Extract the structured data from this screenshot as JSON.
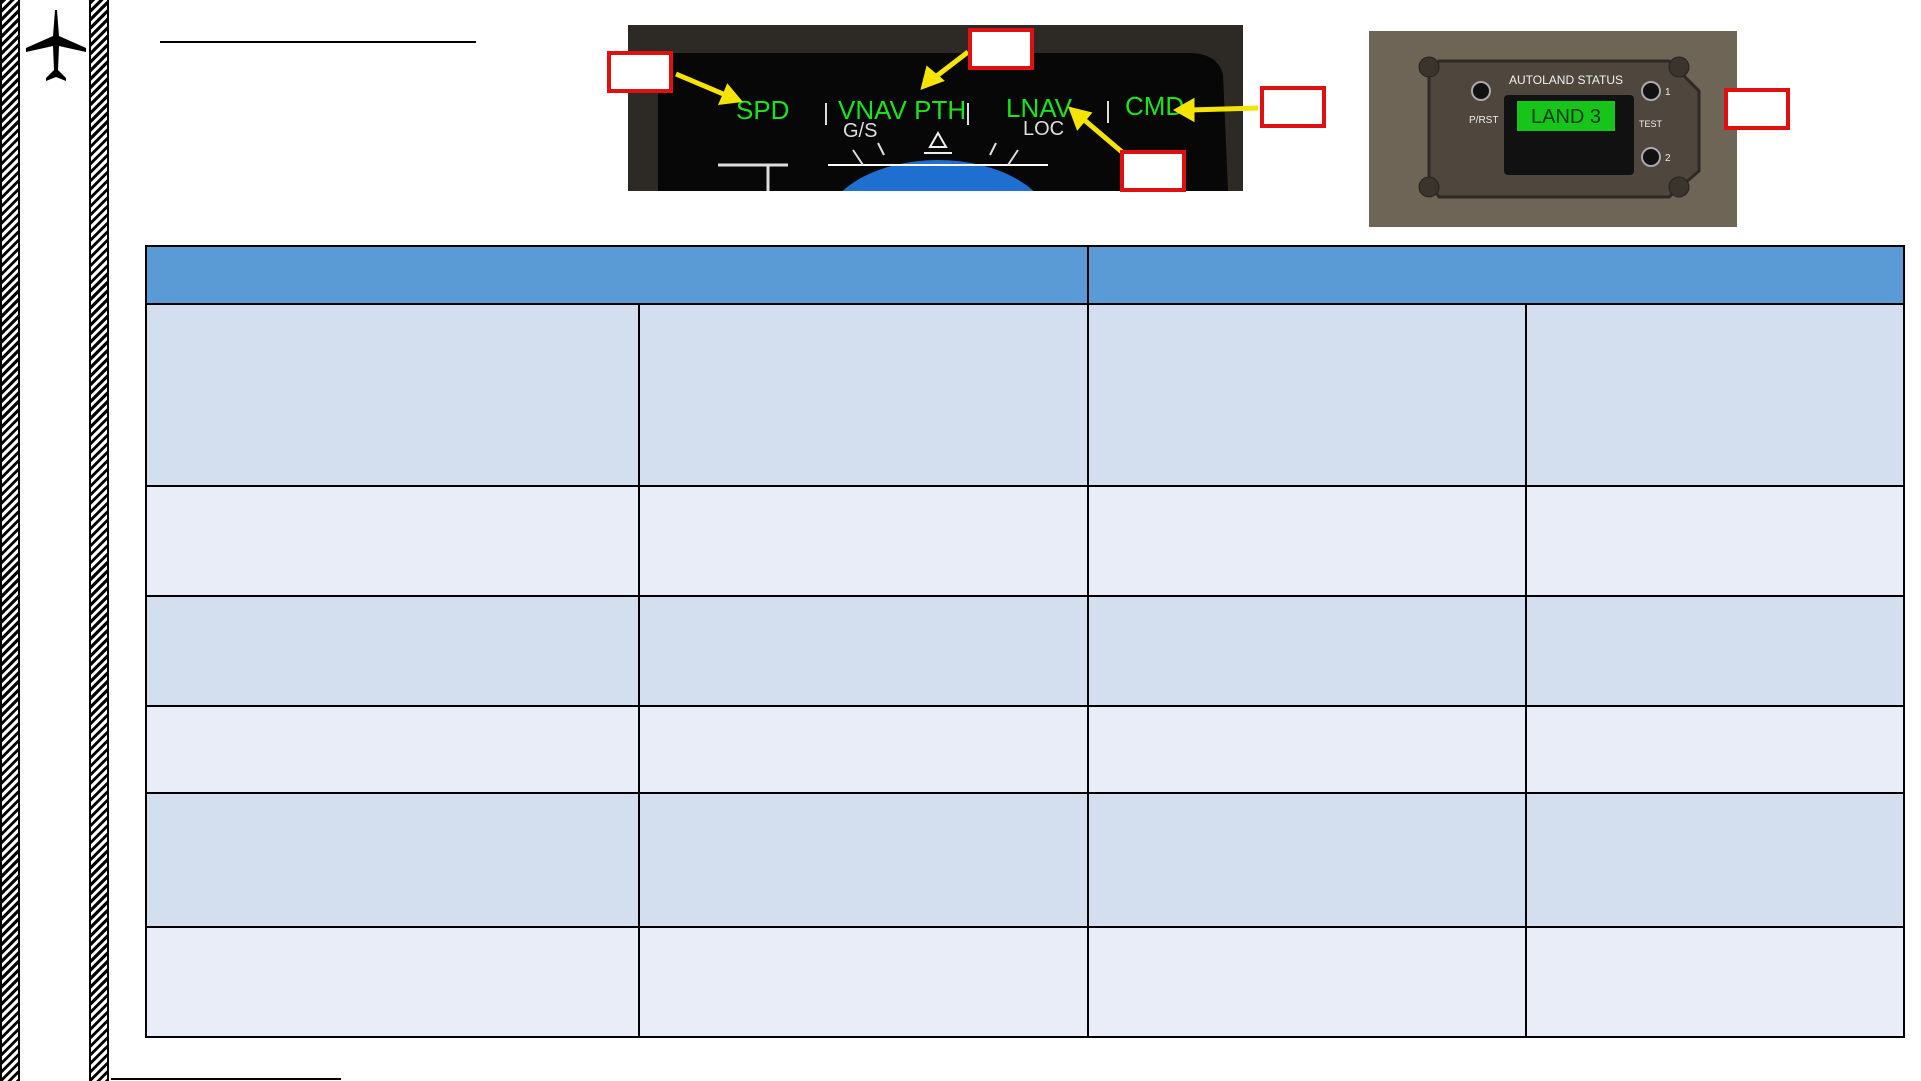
{
  "sidebar": {
    "icon": "airplane-icon"
  },
  "header": {
    "title": ""
  },
  "pfd_image": {
    "annunciators": {
      "speed": "SPD",
      "pitch": "VNAV PTH",
      "pitch_armed": "G/S",
      "roll": "LNAV",
      "roll_armed": "LOC",
      "ap_status": "CMD"
    },
    "callouts": [
      "",
      "",
      "",
      "",
      ""
    ]
  },
  "autoland_image": {
    "panel_title": "AUTOLAND STATUS",
    "display": "LAND 3",
    "reset_label": "P/RST",
    "light_1": "1",
    "light_2": "2",
    "test_label": "TEST",
    "callout": ""
  },
  "table": {
    "headers": [
      "",
      ""
    ],
    "rows": [
      [
        "",
        "",
        "",
        ""
      ],
      [
        "",
        "",
        "",
        ""
      ],
      [
        "",
        "",
        "",
        ""
      ],
      [
        "",
        "",
        "",
        ""
      ],
      [
        "",
        "",
        "",
        ""
      ],
      [
        "",
        "",
        "",
        ""
      ]
    ]
  },
  "colors": {
    "header_blue": "#5b9bd5",
    "row_dark": "#d3deef",
    "row_light": "#e9edf8",
    "callout_red": "#e01010",
    "arrow_yellow": "#f5e400",
    "annunciator_green": "#19e619"
  }
}
